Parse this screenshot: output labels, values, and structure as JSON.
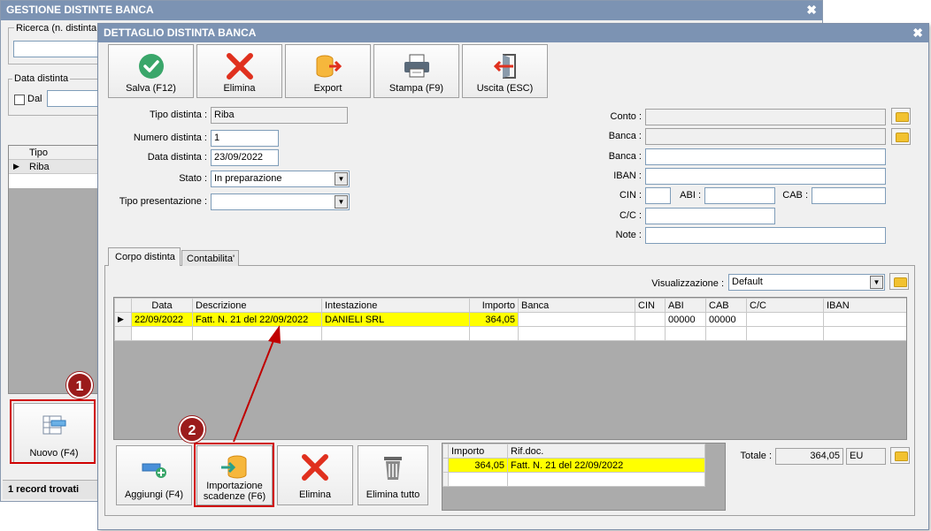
{
  "back_window": {
    "title": "GESTIONE DISTINTE BANCA",
    "close": "✖",
    "search_label": "Ricerca (n. distinta o",
    "date_group_label": "Data distinta",
    "dal_label": "Dal",
    "grid_header": "Tipo",
    "grid_row": "Riba",
    "new_button": "Nuovo (F4)",
    "status": "1 record trovati"
  },
  "front_window": {
    "title": "DETTAGLIO DISTINTA BANCA",
    "close": "✖",
    "toolbar": {
      "save": "Salva (F12)",
      "delete": "Elimina",
      "export": "Export",
      "print": "Stampa (F9)",
      "exit": "Uscita (ESC)"
    },
    "form": {
      "tipo_label": "Tipo distinta :",
      "tipo_value": "Riba",
      "numero_label": "Numero distinta :",
      "numero_value": "1",
      "data_label": "Data distinta :",
      "data_value": "23/09/2022",
      "stato_label": "Stato :",
      "stato_value": "In preparazione",
      "presentazione_label": "Tipo presentazione :",
      "presentazione_value": "",
      "conto_label": "Conto :",
      "banca1_label": "Banca :",
      "banca2_label": "Banca :",
      "iban_label": "IBAN :",
      "cin_label": "CIN :",
      "abi_label": "ABI :",
      "cab_label": "CAB :",
      "cc_label": "C/C :",
      "note_label": "Note :"
    },
    "tabs": [
      "Corpo distinta",
      "Contabilita'"
    ],
    "view_label": "Visualizzazione :",
    "view_value": "Default",
    "grid": {
      "headers": [
        "Data",
        "Descrizione",
        "Intestazione",
        "Importo",
        "Banca",
        "CIN",
        "ABI",
        "CAB",
        "C/C",
        "IBAN"
      ],
      "rows": [
        [
          "22/09/2022",
          "Fatt. N. 21 del 22/09/2022",
          "DANIELI SRL",
          "364,05",
          "",
          "",
          "00000",
          "00000",
          "",
          ""
        ]
      ]
    },
    "bottom_buttons": {
      "add": "Aggiungi (F4)",
      "import_line1": "Importazione",
      "import_line2": "scadenze (F6)",
      "delete": "Elimina",
      "delete_all": "Elimina tutto"
    },
    "subgrid": {
      "headers": [
        "Importo",
        "Rif.doc."
      ],
      "rows": [
        [
          "364,05",
          "Fatt. N. 21 del 22/09/2022"
        ]
      ]
    },
    "total_label": "Totale :",
    "total_value": "364,05",
    "currency": "EU"
  },
  "annotations": {
    "step1": "1",
    "step2": "2"
  },
  "colors": {
    "title_bar": "#7c93b3",
    "highlight": "#ffff00",
    "annotation": "#d00000"
  }
}
